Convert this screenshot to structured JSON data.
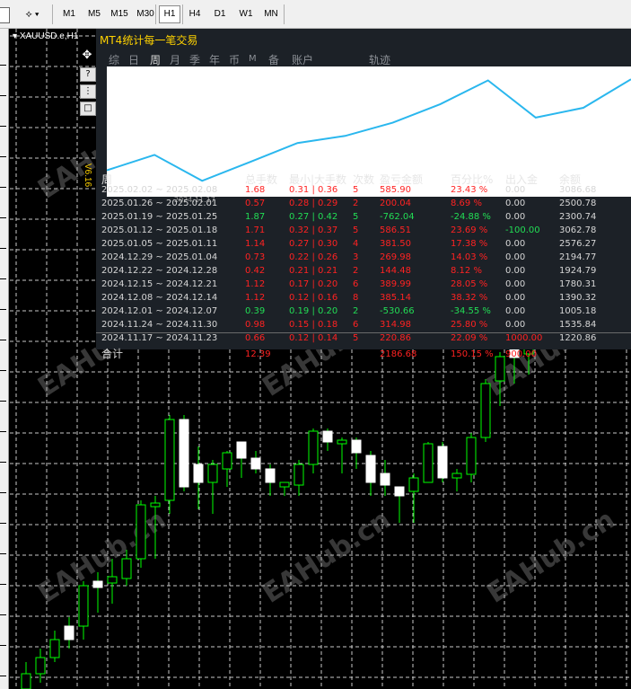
{
  "toolbar": {
    "timeframes": [
      "M1",
      "M5",
      "M15",
      "M30",
      "H1",
      "H4",
      "D1",
      "W1",
      "MN"
    ],
    "active": "H1"
  },
  "chart": {
    "symbol_label": "XAUUSD.e,H1",
    "watermark": "EAHub.cn"
  },
  "sidebar": {
    "move": "✥",
    "help": "?",
    "settings": "⋮",
    "minimize": "□"
  },
  "panel": {
    "title": "MT4统计每一笔交易",
    "version": "V6.16",
    "tabs": [
      "综",
      "日",
      "周",
      "月",
      "季",
      "年",
      "币",
      "M",
      "备",
      "账户",
      "轨迹"
    ],
    "active_tab": "周",
    "graph_date": "2024.11.17",
    "headers": [
      "周",
      "总手数",
      "最小|大手数",
      "次数",
      "盈亏金额",
      "百分比%",
      "出入金",
      "余额"
    ],
    "rows": [
      {
        "period": "2025.02.02 ~ 2025.02.08",
        "lots": "1.68",
        "minmax": "0.31 | 0.36",
        "count": "5",
        "pnl": "585.90",
        "pct": "23.43 %",
        "flow": "0.00",
        "balance": "3086.68",
        "sign": "neg"
      },
      {
        "period": "2025.01.26 ~ 2025.02.01",
        "lots": "0.57",
        "minmax": "0.28 | 0.29",
        "count": "2",
        "pnl": "200.04",
        "pct": "8.69 %",
        "flow": "0.00",
        "balance": "2500.78",
        "sign": "neg"
      },
      {
        "period": "2025.01.19 ~ 2025.01.25",
        "lots": "1.87",
        "minmax": "0.27 | 0.42",
        "count": "5",
        "pnl": "-762.04",
        "pct": "-24.88 %",
        "flow": "0.00",
        "balance": "2300.74",
        "sign": "pos"
      },
      {
        "period": "2025.01.12 ~ 2025.01.18",
        "lots": "1.71",
        "minmax": "0.32 | 0.37",
        "count": "5",
        "pnl": "586.51",
        "pct": "23.69 %",
        "flow": "-100.00",
        "balance": "3062.78",
        "sign": "neg",
        "flowpos": true
      },
      {
        "period": "2025.01.05 ~ 2025.01.11",
        "lots": "1.14",
        "minmax": "0.27 | 0.30",
        "count": "4",
        "pnl": "381.50",
        "pct": "17.38 %",
        "flow": "0.00",
        "balance": "2576.27",
        "sign": "neg"
      },
      {
        "period": "2024.12.29 ~ 2025.01.04",
        "lots": "0.73",
        "minmax": "0.22 | 0.26",
        "count": "3",
        "pnl": "269.98",
        "pct": "14.03 %",
        "flow": "0.00",
        "balance": "2194.77",
        "sign": "neg"
      },
      {
        "period": "2024.12.22 ~ 2024.12.28",
        "lots": "0.42",
        "minmax": "0.21 | 0.21",
        "count": "2",
        "pnl": "144.48",
        "pct": "8.12 %",
        "flow": "0.00",
        "balance": "1924.79",
        "sign": "neg"
      },
      {
        "period": "2024.12.15 ~ 2024.12.21",
        "lots": "1.12",
        "minmax": "0.17 | 0.20",
        "count": "6",
        "pnl": "389.99",
        "pct": "28.05 %",
        "flow": "0.00",
        "balance": "1780.31",
        "sign": "neg"
      },
      {
        "period": "2024.12.08 ~ 2024.12.14",
        "lots": "1.12",
        "minmax": "0.12 | 0.16",
        "count": "8",
        "pnl": "385.14",
        "pct": "38.32 %",
        "flow": "0.00",
        "balance": "1390.32",
        "sign": "neg"
      },
      {
        "period": "2024.12.01 ~ 2024.12.07",
        "lots": "0.39",
        "minmax": "0.19 | 0.20",
        "count": "2",
        "pnl": "-530.66",
        "pct": "-34.55 %",
        "flow": "0.00",
        "balance": "1005.18",
        "sign": "pos"
      },
      {
        "period": "2024.11.24 ~ 2024.11.30",
        "lots": "0.98",
        "minmax": "0.15 | 0.18",
        "count": "6",
        "pnl": "314.98",
        "pct": "25.80 %",
        "flow": "0.00",
        "balance": "1535.84",
        "sign": "neg"
      },
      {
        "period": "2024.11.17 ~ 2024.11.23",
        "lots": "0.66",
        "minmax": "0.12 | 0.14",
        "count": "5",
        "pnl": "220.86",
        "pct": "22.09 %",
        "flow": "1000.00",
        "balance": "1220.86",
        "sign": "neg",
        "flowneg": true
      }
    ],
    "total": {
      "label": "合计",
      "lots": "12.39",
      "pnl": "2186.68",
      "pct": "150.15 %",
      "flow": "900.00"
    }
  }
}
